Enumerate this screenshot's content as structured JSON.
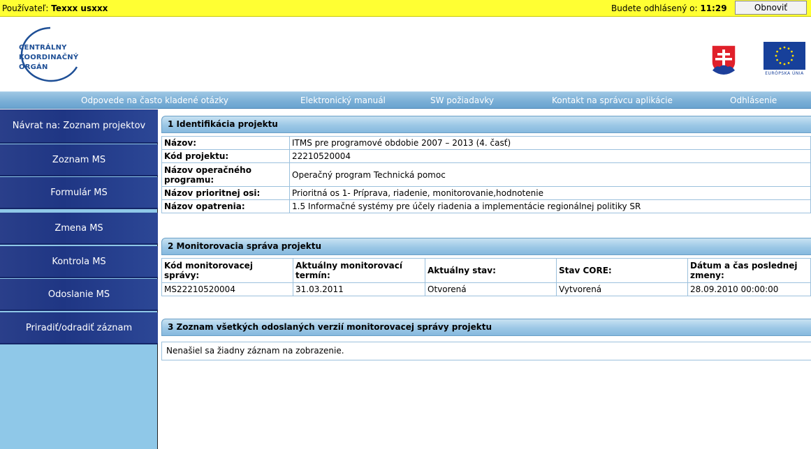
{
  "topbar": {
    "user_prefix": "Používateľ: ",
    "user_name": "Texxx usxxx",
    "logout_prefix": "Budete odhlásený o: ",
    "logout_time": "11:29",
    "refresh_label": "Obnoviť"
  },
  "header": {
    "logo_lines": [
      "CENTRÁLNY",
      "KOORDINAČNÝ",
      "ORGÁN"
    ],
    "eu_label": "EURÓPSKA ÚNIA"
  },
  "nav": {
    "items": [
      "Odpovede na často kladené otázky",
      "Elektronický manuál",
      "SW požiadavky",
      "Kontakt na správcu aplikácie",
      "Odhlásenie"
    ]
  },
  "sidebar": {
    "items": [
      "Návrat na: Zoznam projektov",
      "Zoznam MS",
      "Formulár MS",
      "Zmena MS",
      "Kontrola MS",
      "Odoslanie MS",
      "Priradiť/odradiť záznam"
    ]
  },
  "section1": {
    "title": "1 Identifikácia projektu",
    "rows": [
      {
        "label": "Názov:",
        "value": "ITMS pre programové obdobie 2007 – 2013 (4. časť)"
      },
      {
        "label": "Kód projektu:",
        "value": "22210520004"
      },
      {
        "label": "Názov operačného programu:",
        "value": "Operačný program Technická pomoc"
      },
      {
        "label": "Názov prioritnej osi:",
        "value": "Prioritná os 1- Príprava, riadenie, monitorovanie,hodnotenie"
      },
      {
        "label": "Názov opatrenia:",
        "value": "1.5 Informačné systémy pre účely riadenia a implementácie regionálnej politiky SR"
      }
    ]
  },
  "section2": {
    "title": "2 Monitorovacia správa projektu",
    "columns": [
      "Kód monitorovacej správy:",
      "Aktuálny monitorovací termín:",
      "Aktuálny stav:",
      "Stav CORE:",
      "Dátum a čas poslednej zmeny:"
    ],
    "row": [
      "MS22210520004",
      "31.03.2011",
      "Otvorená",
      "Vytvorená",
      "28.09.2010 00:00:00"
    ]
  },
  "section3": {
    "title": "3 Zoznam všetkých odoslaných verzií monitorovacej správy projektu",
    "empty_message": "Nenašiel sa žiadny záznam na zobrazenie."
  },
  "colors": {
    "topbar": "#ffff33",
    "sidebar_item": "#1f3684",
    "nav": "#79aed6",
    "brand": "#1e4f96"
  }
}
